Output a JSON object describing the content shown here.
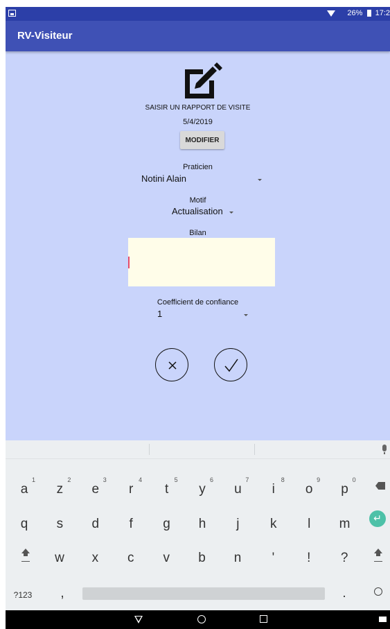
{
  "status_bar": {
    "battery": "26%",
    "time": "17:2"
  },
  "app_bar": {
    "title": "RV-Visiteur"
  },
  "form": {
    "heading": "SAISIR UN RAPPORT DE VISITE",
    "date": "5/4/2019",
    "modify_label": "MODIFIER",
    "praticien_label": "Praticien",
    "praticien_value": "Notini Alain",
    "motif_label": "Motif",
    "motif_value": "Actualisation",
    "bilan_label": "Bilan",
    "bilan_value": "",
    "coefficient_label": "Coefficient de confiance",
    "coefficient_value": "1"
  },
  "keyboard": {
    "row1": [
      {
        "k": "a",
        "h": "1"
      },
      {
        "k": "z",
        "h": "2"
      },
      {
        "k": "e",
        "h": "3"
      },
      {
        "k": "r",
        "h": "4"
      },
      {
        "k": "t",
        "h": "5"
      },
      {
        "k": "y",
        "h": "6"
      },
      {
        "k": "u",
        "h": "7"
      },
      {
        "k": "i",
        "h": "8"
      },
      {
        "k": "o",
        "h": "9"
      },
      {
        "k": "p",
        "h": "0"
      }
    ],
    "row2": [
      "q",
      "s",
      "d",
      "f",
      "g",
      "h",
      "j",
      "k",
      "l",
      "m"
    ],
    "row3": [
      "w",
      "x",
      "c",
      "v",
      "b",
      "n",
      "'",
      "!",
      "?"
    ],
    "symbols_label": "?123",
    "comma": ",",
    "period": "."
  },
  "colors": {
    "app_bar": "#3f51b5",
    "status_bar": "#2c3fa8",
    "background": "#c9d4fb",
    "bilan_box": "#fffde9",
    "enter_key": "#4dc1a8"
  }
}
